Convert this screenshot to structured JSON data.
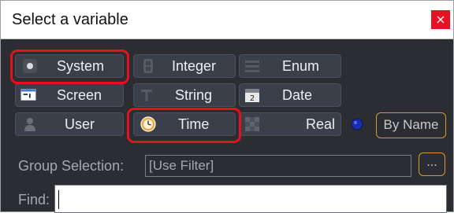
{
  "window": {
    "title": "Select a variable",
    "close_glyph": "×"
  },
  "types": {
    "system": {
      "label": "System",
      "icon": "system-icon"
    },
    "screen": {
      "label": "Screen",
      "icon": "screen-icon"
    },
    "user": {
      "label": "User",
      "icon": "user-icon"
    },
    "integer": {
      "label": "Integer",
      "icon": "integer-icon"
    },
    "string": {
      "label": "String",
      "icon": "string-icon"
    },
    "time": {
      "label": "Time",
      "icon": "clock-icon"
    },
    "enum": {
      "label": "Enum",
      "icon": "enum-icon"
    },
    "date": {
      "label": "Date",
      "icon": "calendar-icon",
      "calendar_day": "2"
    },
    "real": {
      "label": "Real",
      "icon": "real-icon"
    }
  },
  "sort": {
    "by_name_label": "By Name",
    "indicator_color": "#1a2fb0"
  },
  "group": {
    "label": "Group Selection:",
    "value": "[Use Filter]",
    "browse_label": "..."
  },
  "find": {
    "label": "Find:",
    "value": ""
  },
  "colors": {
    "highlight": "#e4121c",
    "accent_orange": "#d89a2c",
    "close_red": "#e81123"
  }
}
